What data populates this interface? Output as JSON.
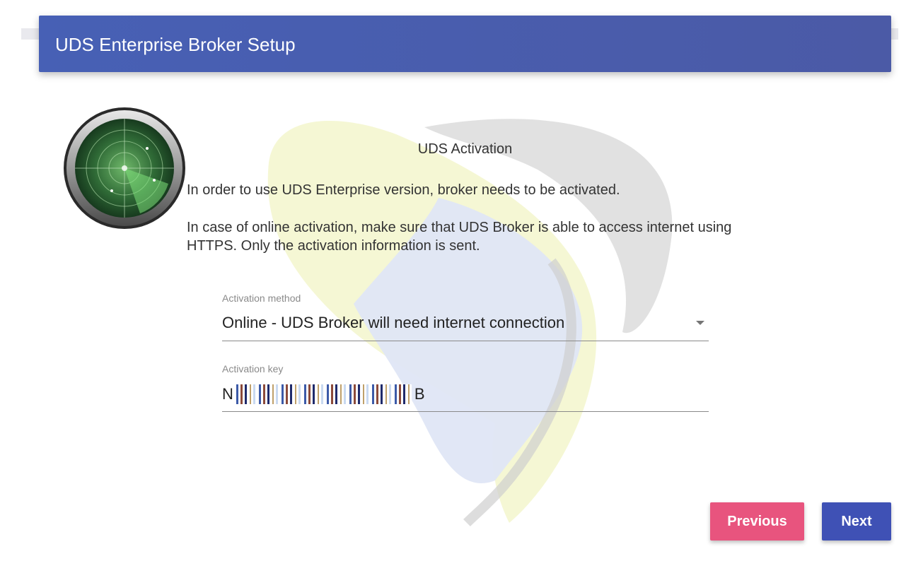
{
  "header": {
    "title": "UDS Enterprise Broker Setup"
  },
  "main": {
    "section_title": "UDS Activation",
    "paragraph1": "In order to use UDS Enterprise version, broker needs to be activated.",
    "paragraph2": "In case of online activation, make sure that UDS Broker is able to access internet using HTTPS. Only the activation information is sent."
  },
  "activation_method": {
    "label": "Activation method",
    "value": "Online - UDS Broker will need internet connection"
  },
  "activation_key": {
    "label": "Activation key",
    "first_char": "N",
    "last_char": "B"
  },
  "buttons": {
    "previous": "Previous",
    "next": "Next"
  },
  "colors": {
    "header": "#4760b5",
    "previous_button": "#e8547e",
    "next_button": "#3f51b5"
  },
  "icons": {
    "logo": "radar-icon",
    "dropdown": "chevron-down-icon"
  }
}
